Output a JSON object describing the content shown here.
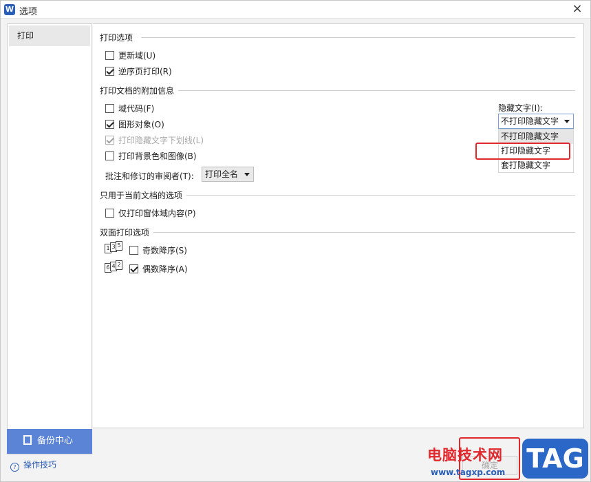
{
  "window": {
    "title": "选项",
    "app_icon_letter": "W"
  },
  "sidebar": {
    "items": [
      {
        "label": "打印"
      }
    ],
    "backup_label": "备份中心",
    "tips_label": "操作技巧"
  },
  "sections": {
    "print_options": {
      "title": "打印选项",
      "items": [
        {
          "label": "更新域(U)",
          "checked": false
        },
        {
          "label": "逆序页打印(R)",
          "checked": true
        }
      ]
    },
    "extra_info": {
      "title": "打印文档的附加信息",
      "items": [
        {
          "label": "域代码(F)",
          "checked": false
        },
        {
          "label": "图形对象(O)",
          "checked": true
        },
        {
          "label": "打印隐藏文字下划线(L)",
          "checked": true,
          "disabled": true
        },
        {
          "label": "打印背景色和图像(B)",
          "checked": false
        }
      ],
      "reviewer_label": "批注和修订的审阅者(T):",
      "reviewer_value": "打印全名",
      "hidden_text_label": "隐藏文字(I):",
      "hidden_text_value": "不打印隐藏文字",
      "hidden_text_options": [
        "不打印隐藏文字",
        "打印隐藏文字",
        "套打隐藏文字"
      ]
    },
    "current_doc": {
      "title": "只用于当前文档的选项",
      "items": [
        {
          "label": "仅打印窗体域内容(P)",
          "checked": false
        }
      ]
    },
    "duplex": {
      "title": "双面打印选项",
      "items": [
        {
          "label": "奇数降序(S)",
          "checked": false,
          "icon_digits": [
            "1",
            "3",
            "5"
          ]
        },
        {
          "label": "偶数降序(A)",
          "checked": true,
          "icon_digits": [
            "6",
            "4",
            "2"
          ]
        }
      ]
    }
  },
  "footer": {
    "ok_label": "确定"
  },
  "watermark": {
    "text": "电脑技术网",
    "url": "www.tagxp.com",
    "logo": "TAG"
  },
  "colors": {
    "accent": "#5b84d6",
    "highlight_red": "#e0272c",
    "link": "#2c5fb7"
  }
}
